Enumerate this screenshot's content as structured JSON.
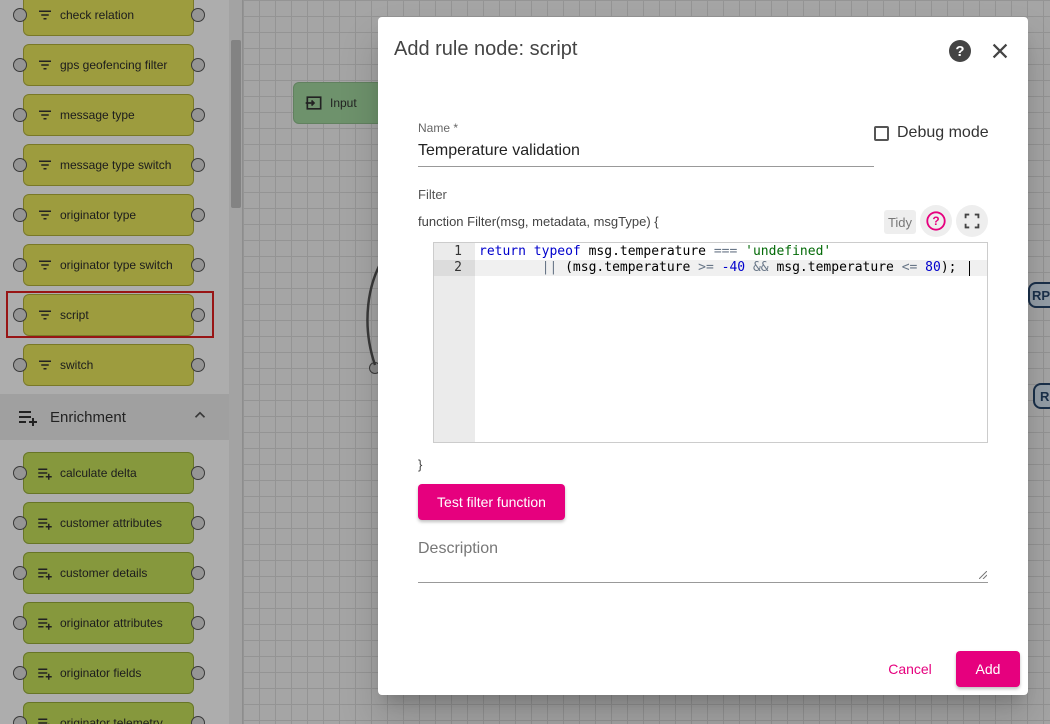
{
  "canvas": {
    "input_node_label": "Input",
    "right_node_labels": [
      "RP",
      "R"
    ]
  },
  "library": {
    "filter_nodes": [
      {
        "label": "check relation"
      },
      {
        "label": "gps geofencing filter"
      },
      {
        "label": "message type"
      },
      {
        "label": "message type switch"
      },
      {
        "label": "originator type"
      },
      {
        "label": "originator type switch"
      },
      {
        "label": "script"
      },
      {
        "label": "switch"
      }
    ],
    "enrichment_section": {
      "title": "Enrichment",
      "expanded": true
    },
    "enrichment_nodes": [
      {
        "label": "calculate delta"
      },
      {
        "label": "customer attributes"
      },
      {
        "label": "customer details"
      },
      {
        "label": "originator attributes"
      },
      {
        "label": "originator fields"
      },
      {
        "label": "originator telemetry"
      }
    ],
    "selected_node": "script"
  },
  "dialog": {
    "title": "Add rule node: script",
    "name_label": "Name *",
    "name_value": "Temperature validation",
    "debug_mode_label": "Debug mode",
    "debug_mode_checked": false,
    "filter_label": "Filter",
    "function_signature": "function Filter(msg, metadata, msgType) {",
    "tidy_label": "Tidy",
    "code_lines": [
      "return typeof msg.temperature === 'undefined'",
      "        || (msg.temperature >= -40 && msg.temperature <= 80);"
    ],
    "line_numbers": [
      "1",
      "2"
    ],
    "closing_brace": "}",
    "test_button_label": "Test filter function",
    "description_placeholder": "Description",
    "cancel_label": "Cancel",
    "add_label": "Add"
  },
  "colors": {
    "accent": "#e6007e",
    "filter_node": "#e7e65c",
    "enrichment_node": "#c6e05a",
    "input_node": "#a3d8a0",
    "selection_outline": "#e02020"
  },
  "icons": {
    "filter_node_icon": "filter-lines-icon",
    "enrichment_node_icon": "playlist-add-icon",
    "input_node_icon": "input-arrow-icon",
    "help": "help-circle-icon",
    "close": "close-icon",
    "fullscreen": "fullscreen-icon"
  }
}
